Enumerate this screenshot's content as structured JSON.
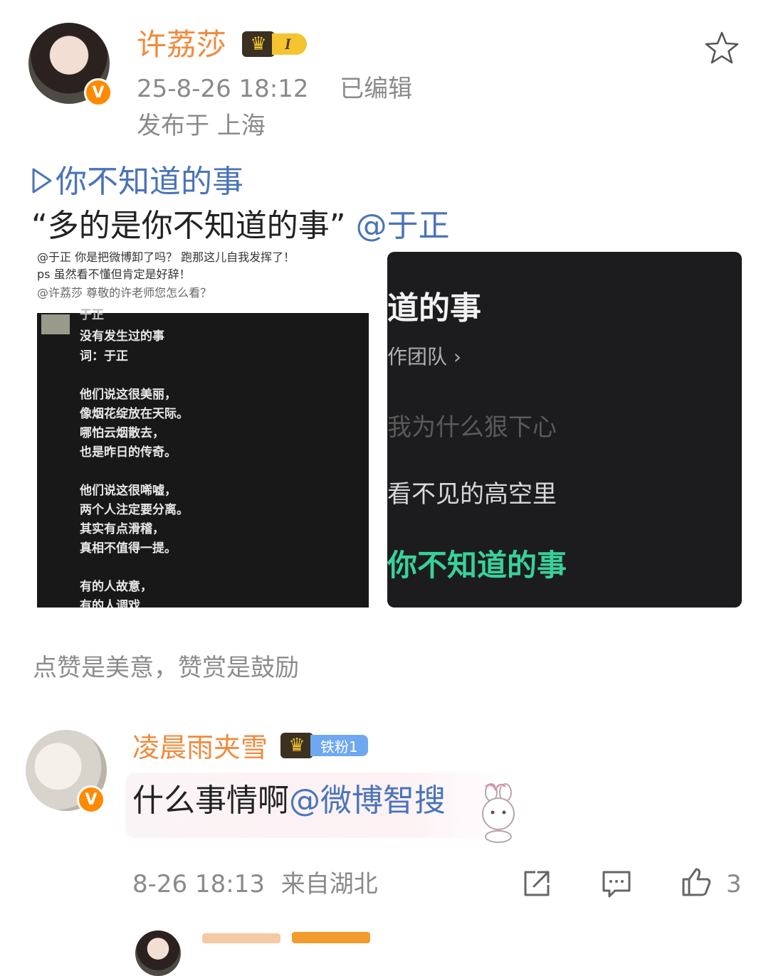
{
  "post": {
    "author": "许荔莎",
    "level_badge": "I",
    "timestamp": "25-8-26 18:12",
    "edited": "已编辑",
    "location": "发布于 上海",
    "song_link": "你不知道的事",
    "quote": "“多的是你不知道的事”",
    "mention": "@于正",
    "image_left": {
      "caption_lines": [
        "@于正 你是把微博卸了吗？ 跑那这儿自我发挥了！",
        "ps 虽然看不懂但肯定是好辞！",
        "@许荔莎 尊敬的许老师您怎么看？"
      ],
      "header_line": "于正",
      "lyrics": [
        "没有发生过的事",
        "词：于正",
        "",
        "他们说这很美丽，",
        "像烟花绽放在天际。",
        "哪怕云烟散去，",
        "也是昨日的传奇。",
        "",
        "他们说这很唏嘘，",
        "两个人注定要分离。",
        "其实有点滑稽，",
        "真相不值得一提。",
        "",
        "有的人故意，",
        "有的人调戏"
      ]
    },
    "image_right": {
      "title": "道的事",
      "team": "作团队 ›",
      "line1": "我为什么狠下心",
      "line2": "看不见的高空里",
      "line3": "你不知道的事"
    },
    "slogan": "点赞是美意，赞赏是鼓励"
  },
  "comment": {
    "author": "凌晨雨夹雪",
    "fan_badge": "铁粉1",
    "text": "什么事情啊",
    "mention": "@微博智搜",
    "timestamp": "8-26 18:13",
    "source": "来自湖北",
    "like_count": "3"
  },
  "icons": {
    "star": "star-outline-icon",
    "share": "share-icon",
    "reply": "comment-icon",
    "like": "thumb-up-icon",
    "verified": "verified-v-icon",
    "crown": "crown-icon"
  },
  "colors": {
    "name_orange": "#f08a3c",
    "link_blue": "#4a74b8",
    "lyric_green": "#37d29a",
    "verified_orange": "#ff8a00"
  }
}
